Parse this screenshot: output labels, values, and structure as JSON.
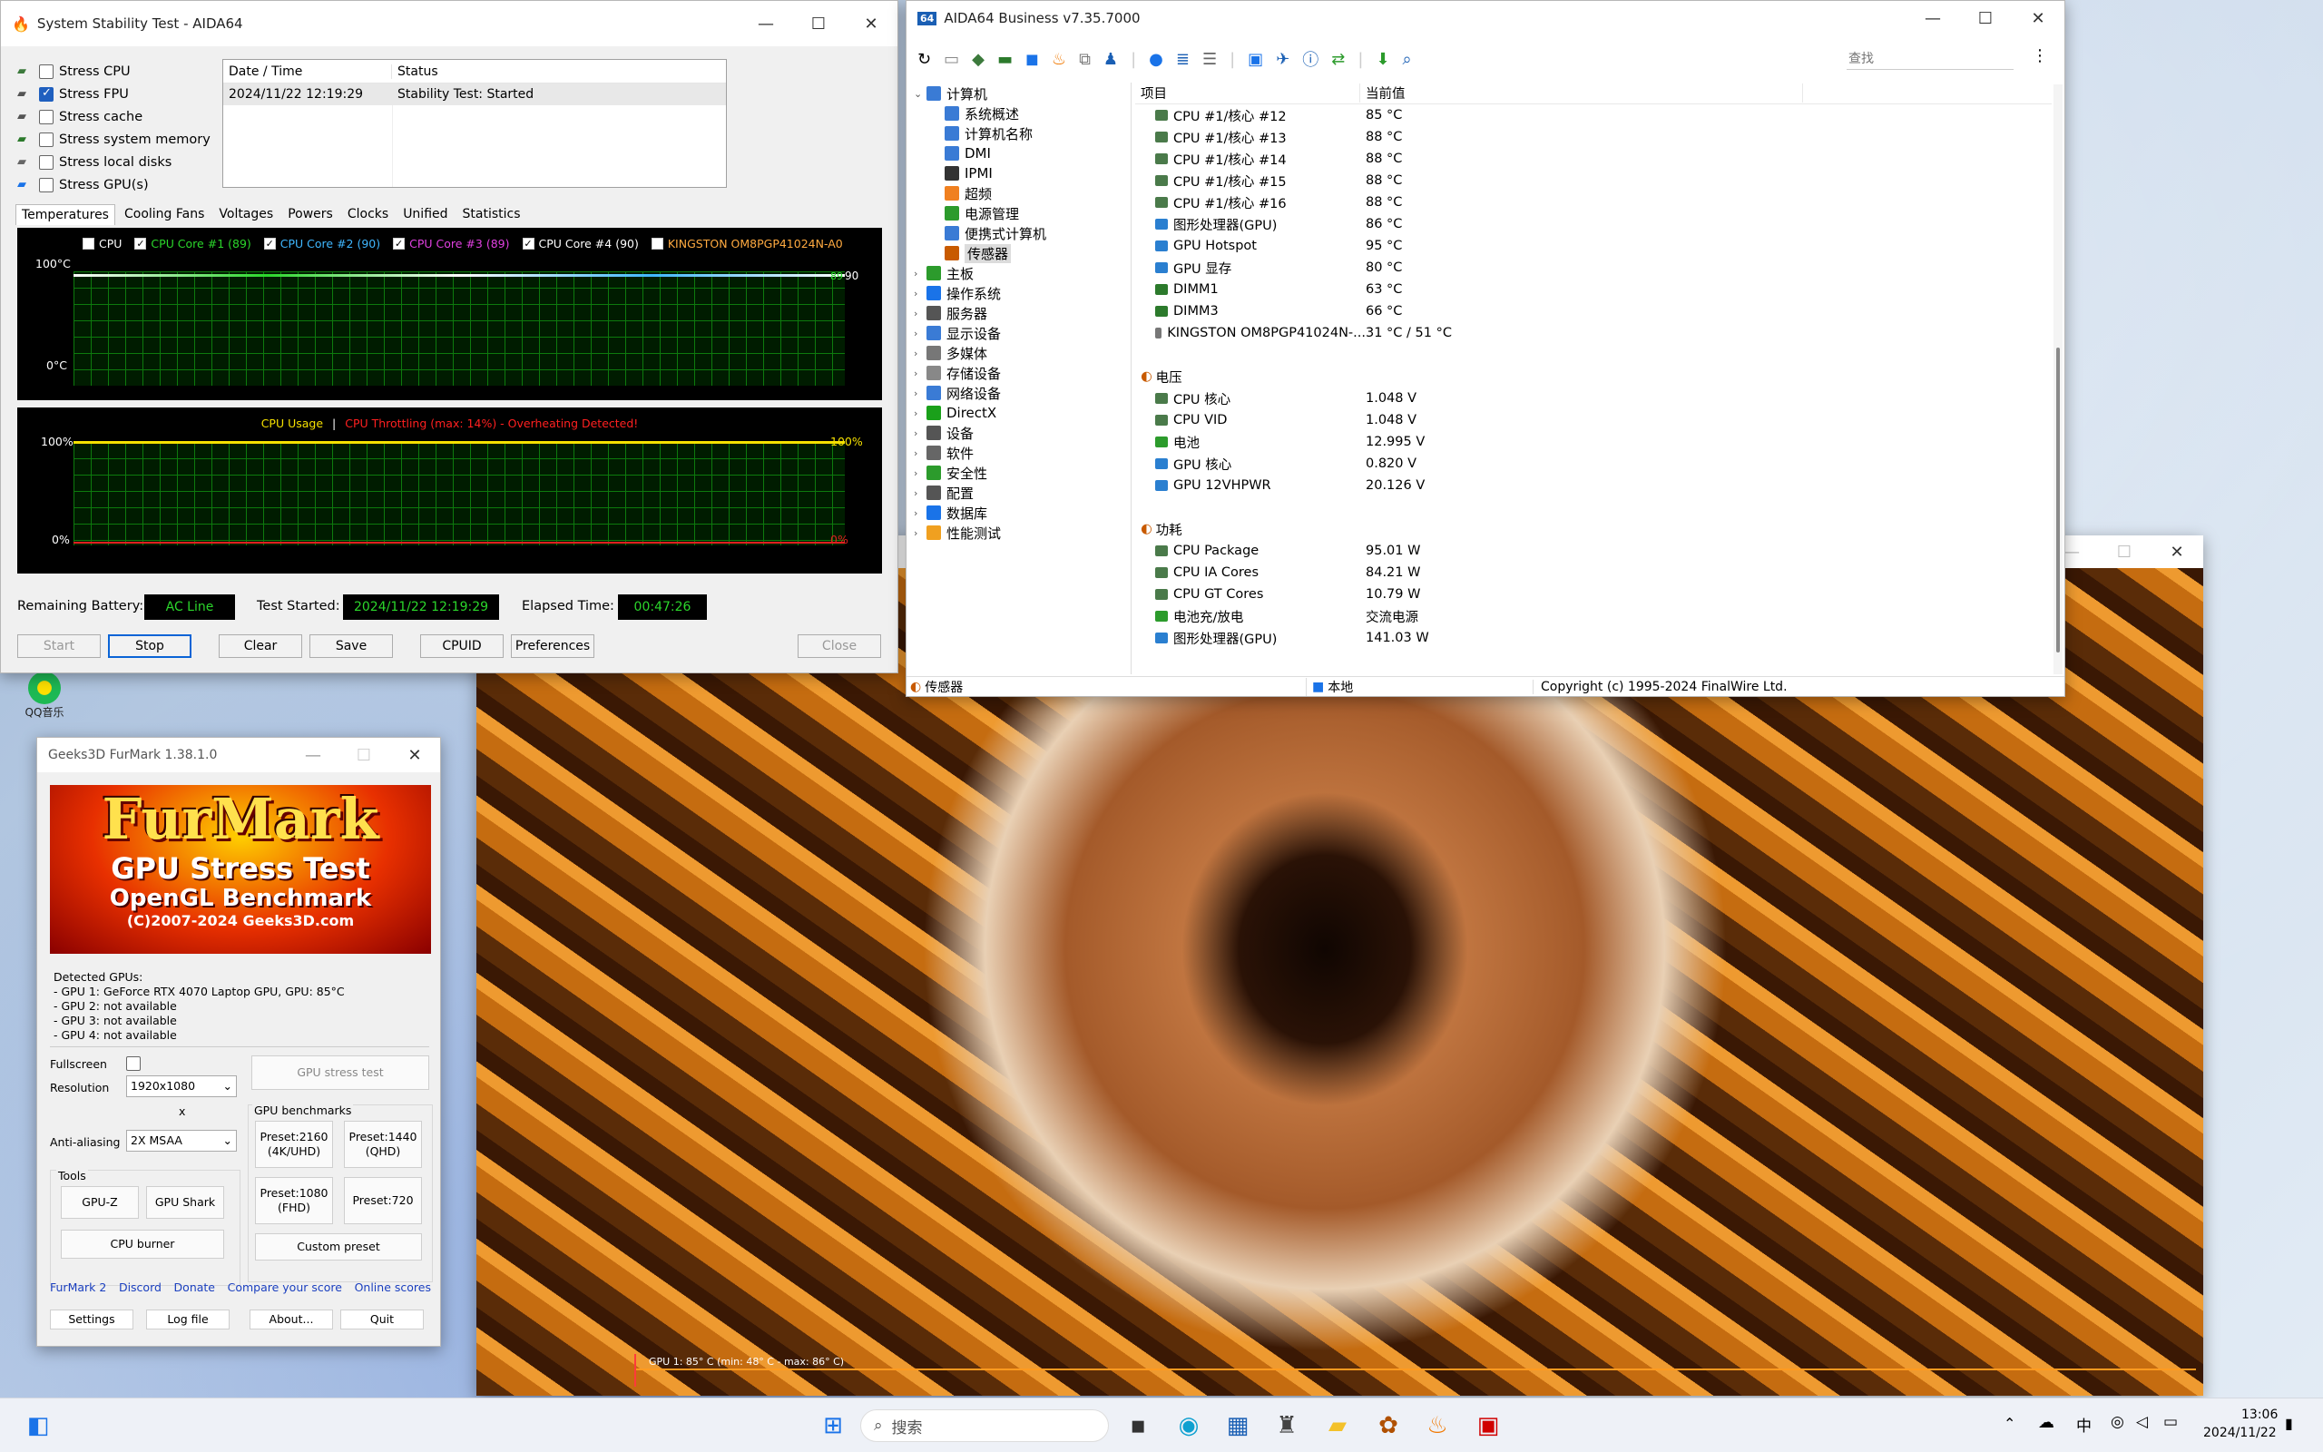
{
  "stability": {
    "title": "System Stability Test - AIDA64",
    "stress": [
      {
        "label": "Stress CPU",
        "checked": false
      },
      {
        "label": "Stress FPU",
        "checked": true
      },
      {
        "label": "Stress cache",
        "checked": false
      },
      {
        "label": "Stress system memory",
        "checked": false
      },
      {
        "label": "Stress local disks",
        "checked": false
      },
      {
        "label": "Stress GPU(s)",
        "checked": false
      }
    ],
    "log_headers": [
      "Date / Time",
      "Status"
    ],
    "log_rows": [
      [
        "2024/11/22 12:19:29",
        "Stability Test: Started"
      ]
    ],
    "tabs": [
      "Temperatures",
      "Cooling Fans",
      "Voltages",
      "Powers",
      "Clocks",
      "Unified",
      "Statistics"
    ],
    "legend": [
      {
        "label": "CPU",
        "checked": false,
        "color": "#ffffff"
      },
      {
        "label": "CPU Core #1 (89)",
        "checked": true,
        "color": "#2bd62b"
      },
      {
        "label": "CPU Core #2 (90)",
        "checked": true,
        "color": "#3fb7ff"
      },
      {
        "label": "CPU Core #3 (89)",
        "checked": true,
        "color": "#e040e0"
      },
      {
        "label": "CPU Core #4 (90)",
        "checked": true,
        "color": "#ffffff"
      },
      {
        "label": "KINGSTON OM8PGP41024N-A0",
        "checked": false,
        "color": "#ffaa40"
      }
    ],
    "temp_top": "100°C",
    "temp_bottom": "0°C",
    "temp_right_a": "89",
    "temp_right_b": "90",
    "cpu_usage": "CPU Usage",
    "sep": "|",
    "throttle": "CPU Throttling (max: 14%) - Overheating Detected!",
    "usage_top_left": "100%",
    "usage_bottom_left": "0%",
    "usage_top_right": "100%",
    "usage_bottom_right": "0%",
    "battery_label": "Remaining Battery:",
    "battery": "AC Line",
    "started_label": "Test Started:",
    "started": "2024/11/22 12:19:29",
    "elapsed_label": "Elapsed Time:",
    "elapsed": "00:47:26",
    "buttons": {
      "start": "Start",
      "stop": "Stop",
      "clear": "Clear",
      "save": "Save",
      "cpuid": "CPUID",
      "prefs": "Preferences",
      "close": "Close"
    }
  },
  "aida": {
    "title": "AIDA64 Business v7.35.7000",
    "search_placeholder": "查找",
    "tree": [
      {
        "label": "计算机",
        "expanded": true,
        "color": "#3a7bd5",
        "level": 0
      },
      {
        "label": "系统概述",
        "level": 1,
        "color": "#3a7bd5"
      },
      {
        "label": "计算机名称",
        "level": 1,
        "color": "#3a7bd5"
      },
      {
        "label": "DMI",
        "level": 1,
        "color": "#3a7bd5"
      },
      {
        "label": "IPMI",
        "level": 1,
        "color": "#333"
      },
      {
        "label": "超频",
        "level": 1,
        "color": "#f08020"
      },
      {
        "label": "电源管理",
        "level": 1,
        "color": "#2c9b2c"
      },
      {
        "label": "便携式计算机",
        "level": 1,
        "color": "#3a7bd5"
      },
      {
        "label": "传感器",
        "level": 1,
        "color": "#c85a00",
        "selected": true
      },
      {
        "label": "主板",
        "level": 0,
        "color": "#2c9b2c"
      },
      {
        "label": "操作系统",
        "level": 0,
        "color": "#1a73e8"
      },
      {
        "label": "服务器",
        "level": 0,
        "color": "#555"
      },
      {
        "label": "显示设备",
        "level": 0,
        "color": "#3a7bd5"
      },
      {
        "label": "多媒体",
        "level": 0,
        "color": "#777"
      },
      {
        "label": "存储设备",
        "level": 0,
        "color": "#888"
      },
      {
        "label": "网络设备",
        "level": 0,
        "color": "#3a7bd5"
      },
      {
        "label": "DirectX",
        "level": 0,
        "color": "#1aa01a"
      },
      {
        "label": "设备",
        "level": 0,
        "color": "#555"
      },
      {
        "label": "软件",
        "level": 0,
        "color": "#666"
      },
      {
        "label": "安全性",
        "level": 0,
        "color": "#2c9b2c"
      },
      {
        "label": "配置",
        "level": 0,
        "color": "#555"
      },
      {
        "label": "数据库",
        "level": 0,
        "color": "#1a73e8"
      },
      {
        "label": "性能测试",
        "level": 0,
        "color": "#f0a020"
      }
    ],
    "col_item": "项目",
    "col_value": "当前值",
    "rows": [
      {
        "name": "CPU #1/核心 #12",
        "value": "85 °C",
        "icon": "cpu"
      },
      {
        "name": "CPU #1/核心 #13",
        "value": "88 °C",
        "icon": "cpu"
      },
      {
        "name": "CPU #1/核心 #14",
        "value": "88 °C",
        "icon": "cpu"
      },
      {
        "name": "CPU #1/核心 #15",
        "value": "88 °C",
        "icon": "cpu"
      },
      {
        "name": "CPU #1/核心 #16",
        "value": "88 °C",
        "icon": "cpu"
      },
      {
        "name": "图形处理器(GPU)",
        "value": "86 °C",
        "icon": "gpu"
      },
      {
        "name": "GPU Hotspot",
        "value": "95 °C",
        "icon": "gpu"
      },
      {
        "name": "GPU 显存",
        "value": "80 °C",
        "icon": "gpu"
      },
      {
        "name": "DIMM1",
        "value": "63 °C",
        "icon": "ram"
      },
      {
        "name": "DIMM3",
        "value": "66 °C",
        "icon": "ram"
      },
      {
        "name": "KINGSTON OM8PGP41024N-...",
        "value": "31 °C / 51 °C",
        "icon": "disk"
      },
      {
        "section": "电压"
      },
      {
        "name": "CPU 核心",
        "value": "1.048 V",
        "icon": "cpu"
      },
      {
        "name": "CPU VID",
        "value": "1.048 V",
        "icon": "cpu"
      },
      {
        "name": "电池",
        "value": "12.995 V",
        "icon": "bat"
      },
      {
        "name": "GPU 核心",
        "value": "0.820 V",
        "icon": "gpu"
      },
      {
        "name": "GPU 12VHPWR",
        "value": "20.126 V",
        "icon": "gpu"
      },
      {
        "section": "功耗"
      },
      {
        "name": "CPU Package",
        "value": "95.01 W",
        "icon": "cpu"
      },
      {
        "name": "CPU IA Cores",
        "value": "84.21 W",
        "icon": "cpu"
      },
      {
        "name": "CPU GT Cores",
        "value": "10.79 W",
        "icon": "cpu"
      },
      {
        "name": "电池充/放电",
        "value": "交流电源",
        "icon": "bat"
      },
      {
        "name": "图形处理器(GPU)",
        "value": "141.03 W",
        "icon": "gpu"
      }
    ],
    "status_left": "传感器",
    "status_mid": "本地",
    "status_right": "Copyright (c) 1995-2024 FinalWire Ltd."
  },
  "furmark": {
    "title": "Geeks3D FurMark 1.38.1.0",
    "logo_big": "FurMark",
    "logo_l2": "GPU Stress Test",
    "logo_l3": "OpenGL Benchmark",
    "logo_l4": "(C)2007-2024 Geeks3D.com",
    "detected": [
      "Detected GPUs:",
      "- GPU 1: GeForce RTX 4070 Laptop GPU, GPU: 85°C",
      "- GPU 2: not available",
      "- GPU 3: not available",
      "- GPU 4: not available"
    ],
    "fullscreen": "Fullscreen",
    "resolution_label": "Resolution",
    "resolution": "1920x1080",
    "x": "x",
    "aa_label": "Anti-aliasing",
    "aa": "2X MSAA",
    "stress_btn": "GPU stress test",
    "bench_label": "GPU benchmarks",
    "p2160": "Preset:2160\n(4K/UHD)",
    "p1440": "Preset:1440\n(QHD)",
    "p1080": "Preset:1080\n(FHD)",
    "p720": "Preset:720",
    "custom": "Custom preset",
    "tools_label": "Tools",
    "gpuz": "GPU-Z",
    "shark": "GPU Shark",
    "burner": "CPU burner",
    "links": [
      "FurMark 2",
      "Discord",
      "Donate",
      "Compare your score",
      "Online scores"
    ],
    "settings": "Settings",
    "log": "Log file",
    "about": "About...",
    "quit": "Quit"
  },
  "render": {
    "overlay": "GPU 1: 85° C (min: 48° C - max: 86° C)"
  },
  "desktop": {
    "icon_label": "QQ音乐"
  },
  "taskbar": {
    "search": "搜索",
    "ime": "中",
    "time": "13:06",
    "date": "2024/11/22"
  }
}
